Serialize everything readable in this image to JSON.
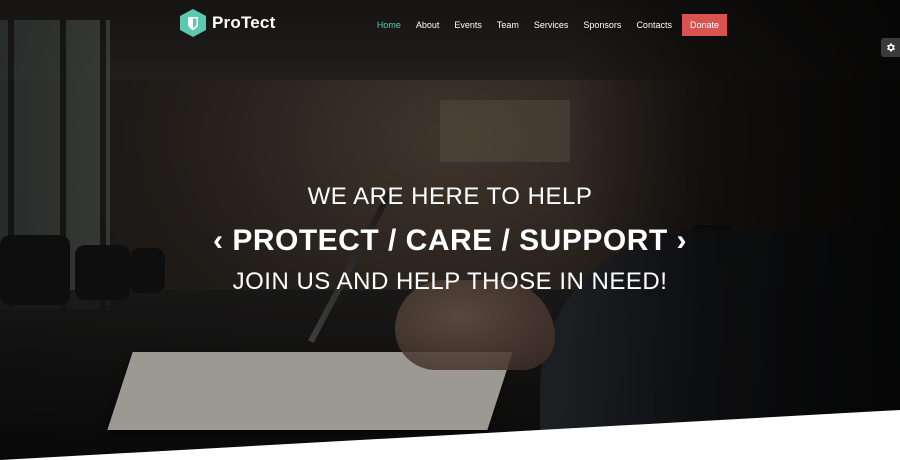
{
  "brand": {
    "name": "ProTect"
  },
  "nav": {
    "items": [
      "Home",
      "About",
      "Events",
      "Team",
      "Services",
      "Sponsors",
      "Contacts"
    ],
    "donate_label": "Donate"
  },
  "hero": {
    "line1": "WE ARE HERE TO HELP",
    "line2": "PROTECT / CARE / SUPPORT",
    "line3": "JOIN US AND HELP THOSE IN NEED!",
    "prev_glyph": "‹",
    "next_glyph": "›"
  },
  "colors": {
    "accent": "#5cc8b0",
    "donate": "#d9534f"
  },
  "icons": {
    "logo": "shield-icon",
    "settings": "gear-icon"
  }
}
